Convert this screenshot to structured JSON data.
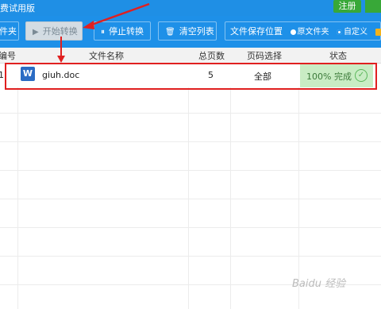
{
  "titlebar": {
    "title": "费试用版",
    "register_label": "注册"
  },
  "toolbar": {
    "prev_label": "件夹",
    "start_label": "开始转换",
    "stop_label": "停止转换",
    "clear_label": "清空列表",
    "save_location_label": "文件保存位置",
    "option_original": "原文件夹",
    "option_custom": "自定义"
  },
  "table": {
    "headers": {
      "index": "编号",
      "filename": "文件名称",
      "pages": "总页数",
      "page_select": "页码选择",
      "status": "状态"
    },
    "rows": [
      {
        "index": "1",
        "filename": "giuh.doc",
        "pages": "5",
        "page_select": "全部",
        "status": "100% 完成",
        "icon": "word-icon"
      }
    ]
  },
  "watermark": "Baidu 经验",
  "colors": {
    "accent": "#1e90e8",
    "success": "#c9ecc4",
    "highlight": "#e02020"
  }
}
